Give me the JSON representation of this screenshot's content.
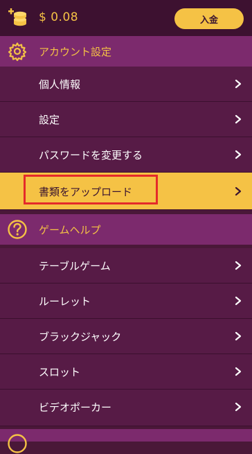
{
  "header": {
    "balance": "$ 0.08",
    "deposit_label": "入金",
    "icon": "coins-plus-icon"
  },
  "account_section": {
    "title": "アカウント設定",
    "icon": "gear-icon",
    "items": [
      {
        "label": "個人情報"
      },
      {
        "label": "設定"
      },
      {
        "label": "パスワードを変更する"
      },
      {
        "label": "書類をアップロード",
        "active": true,
        "highlighted": true
      }
    ]
  },
  "help_section": {
    "title": "ゲームヘルプ",
    "icon": "question-circle-icon",
    "items": [
      {
        "label": "テーブルゲーム"
      },
      {
        "label": "ルーレット"
      },
      {
        "label": "ブラックジャック"
      },
      {
        "label": "スロット"
      },
      {
        "label": "ビデオポーカー"
      }
    ]
  },
  "colors": {
    "accent": "#f5c245",
    "section_bg": "#7c2a6d",
    "row_bg": "#571b46",
    "highlight": "#e52a2a"
  }
}
